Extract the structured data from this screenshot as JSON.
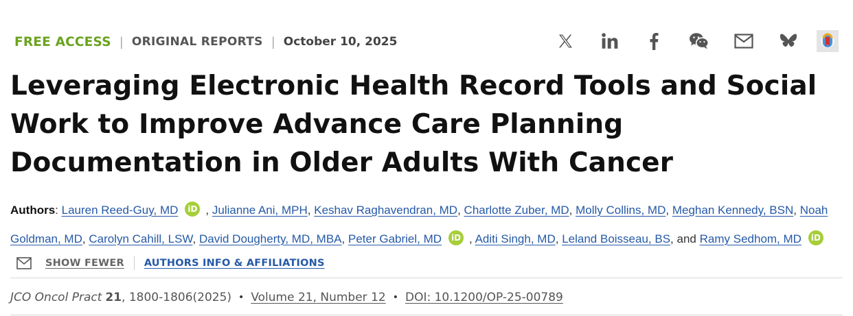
{
  "meta": {
    "access": "FREE ACCESS",
    "type": "ORIGINAL REPORTS",
    "date": "October 10, 2025",
    "separator": "|"
  },
  "share": {
    "icons": [
      "x-icon",
      "linkedin-icon",
      "facebook-icon",
      "wechat-icon",
      "email-icon",
      "bluesky-icon",
      "bookmark-icon"
    ]
  },
  "article": {
    "title": "Leveraging Electronic Health Record Tools and Social Work to Improve Advance Care Planning Documentation in Older Adults With Cancer"
  },
  "authors": {
    "label": "Authors",
    "label_suffix": ": ",
    "list": [
      {
        "name": "Lauren Reed-Guy, MD",
        "orcid": true
      },
      {
        "name": "Julianne Ani, MPH",
        "orcid": false
      },
      {
        "name": "Keshav Raghavendran, MD",
        "orcid": false
      },
      {
        "name": "Charlotte Zuber, MD",
        "orcid": false
      },
      {
        "name": "Molly Collins, MD",
        "orcid": false
      },
      {
        "name": "Meghan Kennedy, BSN",
        "orcid": false
      },
      {
        "name": "Noah Goldman, MD",
        "orcid": false
      },
      {
        "name": "Carolyn Cahill, LSW",
        "orcid": false
      },
      {
        "name": "David Dougherty, MD, MBA",
        "orcid": false
      },
      {
        "name": "Peter Gabriel, MD",
        "orcid": true
      },
      {
        "name": "Aditi Singh, MD",
        "orcid": false
      },
      {
        "name": "Leland Boisseau, BS",
        "orcid": false
      },
      {
        "name": "Ramy Sedhom, MD",
        "orcid": true
      }
    ],
    "comma": ",",
    "and": "and",
    "orcid_label": "iD"
  },
  "actions": {
    "show_fewer": "SHOW FEWER",
    "affiliations": "AUTHORS INFO & AFFILIATIONS"
  },
  "citation": {
    "journal": "JCO Oncol Pract",
    "volume": "21",
    "pages": ", 1800-1806(2025)",
    "bullet": "•",
    "issue": "Volume 21, Number 12",
    "doi": "DOI: 10.1200/OP-25-00789"
  },
  "colors": {
    "access_green": "#6aa31d",
    "link_blue": "#2559a7",
    "orcid_green": "#a6ce39"
  }
}
